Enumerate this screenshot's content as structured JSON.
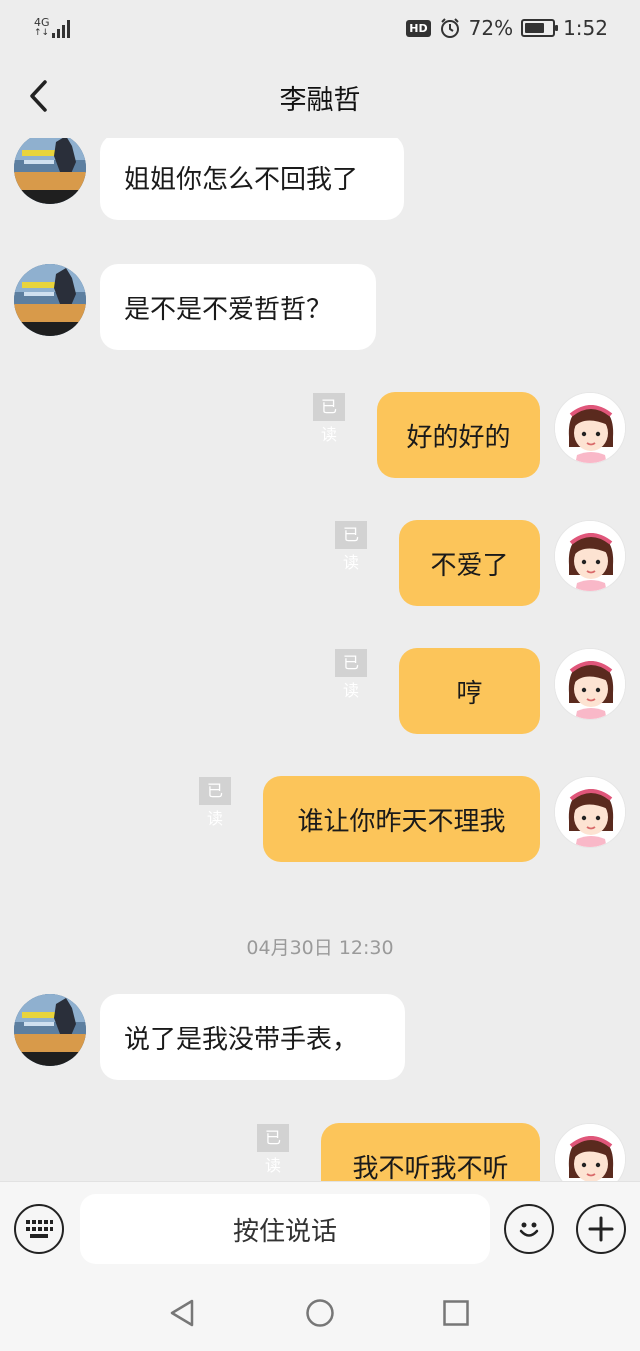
{
  "status_bar": {
    "network": "4G",
    "network_sub": "↑↓",
    "hd": "HD",
    "battery": "72%",
    "battery_level": 0.72,
    "time": "1:52"
  },
  "header": {
    "title": "李融哲"
  },
  "messages": [
    {
      "side": "other",
      "text": "姐姐你怎么不回我了"
    },
    {
      "side": "other",
      "text": "是不是不爱哲哲？"
    },
    {
      "side": "self",
      "text": "好的好的",
      "status": "已读"
    },
    {
      "side": "self",
      "text": "不爱了",
      "status": "已读"
    },
    {
      "side": "self",
      "text": "哼",
      "status": "已读"
    },
    {
      "side": "self",
      "text": "谁让你昨天不理我",
      "status": "已读"
    },
    {
      "side": "other",
      "text": "说了是我没带手表，"
    },
    {
      "side": "self",
      "text": "我不听我不听",
      "status": "已读"
    }
  ],
  "timestamp": "04月30日 12:30",
  "input": {
    "voice_label": "按住说话"
  },
  "colors": {
    "background": "#ededed",
    "self_bubble": "#fcc55a",
    "other_bubble": "#ffffff",
    "read_badge": "#d2d2d2"
  }
}
